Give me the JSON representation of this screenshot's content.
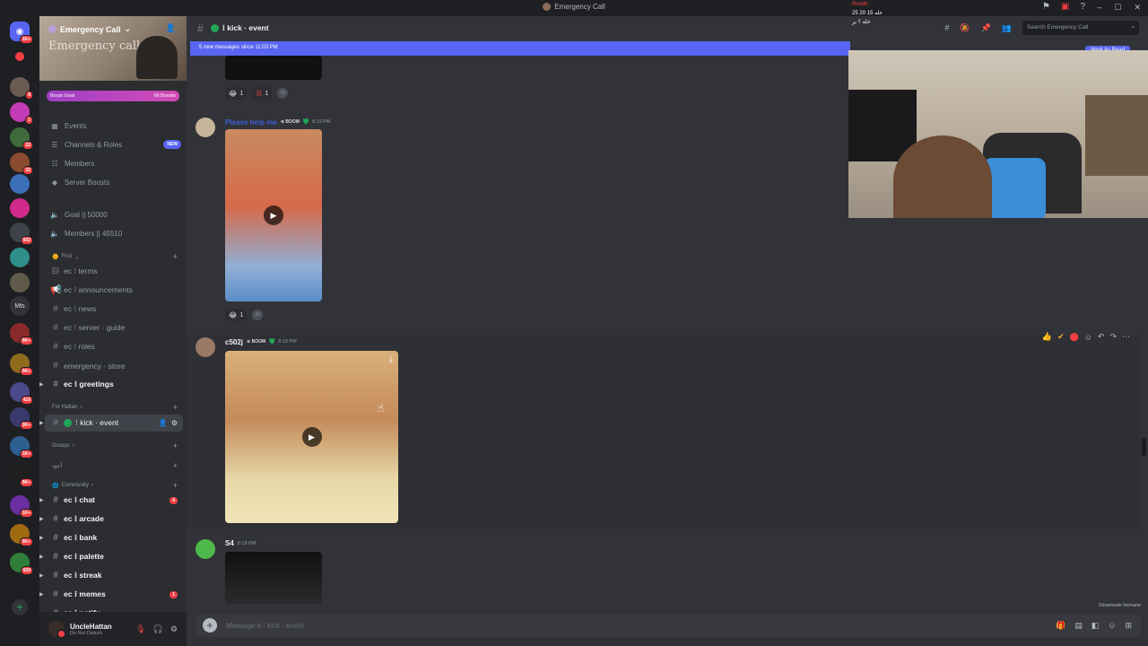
{
  "window": {
    "title": "Emergency Call"
  },
  "guild_badges": [
    "1K+",
    "9",
    "1",
    "22",
    "22",
    "502",
    "9K+",
    "9K+",
    "416",
    "3K+",
    "1K+",
    "9K+",
    "1K+",
    "9K+",
    "659"
  ],
  "guild_mts": "Mts",
  "server": {
    "name": "Emergency Call",
    "banner_text": "Emergency call",
    "boost_goal_label": "Boost Goal",
    "boost_count": "66 Boosts"
  },
  "nav": {
    "events": "Events",
    "channels_roles": "Channels & Roles",
    "new_badge": "NEW",
    "members": "Members",
    "server_boosts": "Server Boosts",
    "goal": "Goal || 50000",
    "member_count": "Members || 45510"
  },
  "categories": {
    "first": "First",
    "for_hattan": "For Hattan",
    "groups": "Groups",
    "arabic": "أعود",
    "community": "Community"
  },
  "channels": {
    "terms": "ec ⁝ terms",
    "announcements": "ec ⁝ announcements",
    "news": "ec ⁝ news",
    "server_guide": "ec ⁝ server · guide",
    "roles": "ec ⁝ roles",
    "store": "emergency · store",
    "greetings": "ec ⁝ greetings",
    "kick_event": "⁝ kick · event",
    "chat": "ec ⁝ chat",
    "chat_badge": "4",
    "arcade": "ec ⁝ arcade",
    "bank": "ec ⁝ bank",
    "palette": "ec ⁝ palette",
    "streak": "ec ⁝ streak",
    "memes": "ec ⁝ memes",
    "memes_badge": "1",
    "notify": "ec ⁝ notify"
  },
  "user": {
    "name": "UncleHattan",
    "status": "Do Not Disturb"
  },
  "header": {
    "channel": "⁝ kick · event",
    "new_messages": "5 new messages since 11:03 PM",
    "mark_read": "Mark As Read",
    "search_placeholder": "Search Emergency Call"
  },
  "overlay": {
    "line1": "Rondk :",
    "line2": "خله 15 20 25",
    "line3": "خله ؟ بر"
  },
  "messages": [
    {
      "author": "Please help me",
      "tag": "BOOM",
      "time": "8:19 PM"
    },
    {
      "author": "c502j",
      "tag": "BOOM",
      "time": "8:19 PM"
    },
    {
      "author": "S4",
      "tag": "",
      "time": "8:19 PM"
    }
  ],
  "reactions": {
    "first": [
      {
        "emoji": "😂",
        "count": "1"
      },
      {
        "emoji": "🇳",
        "count": "1"
      }
    ],
    "second": [
      {
        "emoji": "😂",
        "count": "1"
      }
    ]
  },
  "composer": {
    "placeholder": "Message #  ⁝ kick · event"
  },
  "slowmode": "Slowmode Immune",
  "colors": {
    "blurple": "#5865f2",
    "red": "#f23f43",
    "green": "#23a55a",
    "bg": "#313338",
    "sidebar": "#2b2d31"
  }
}
